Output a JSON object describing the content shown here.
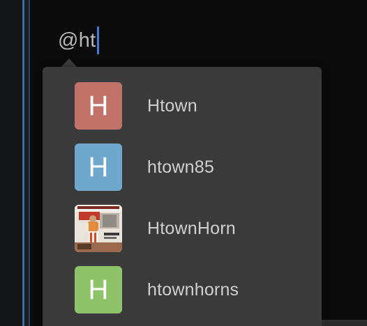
{
  "composer": {
    "text": "@ht"
  },
  "suggestions": [
    {
      "username": "Htown",
      "avatar_letter": "H",
      "avatar_color": "#c1736a",
      "avatar_type": "letter"
    },
    {
      "username": "htown85",
      "avatar_letter": "H",
      "avatar_color": "#6fa8cc",
      "avatar_type": "letter"
    },
    {
      "username": "HtownHorn",
      "avatar_letter": "",
      "avatar_color": "",
      "avatar_type": "photo"
    },
    {
      "username": "htownhorns",
      "avatar_letter": "H",
      "avatar_color": "#8fc36a",
      "avatar_type": "letter"
    }
  ],
  "colors": {
    "background": "#0b0b0b",
    "popover": "#3a3a3a",
    "caret": "#3f7fd6",
    "text": "#d0d0d0"
  }
}
